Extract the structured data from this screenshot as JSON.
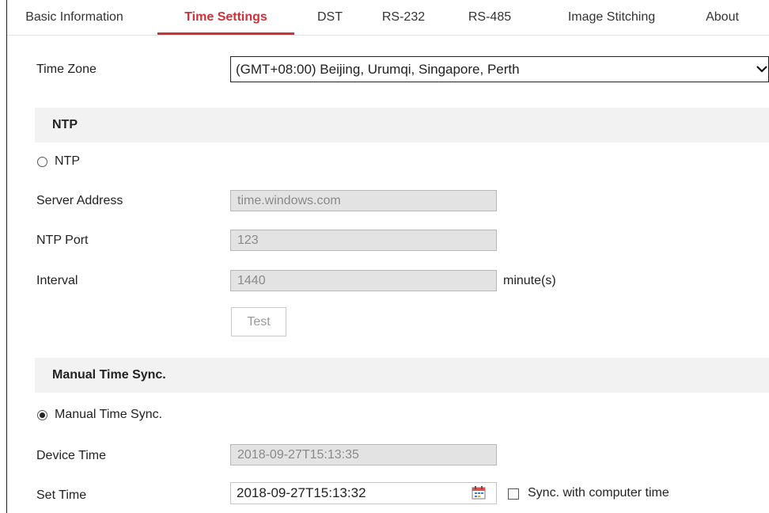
{
  "tabs": [
    {
      "label": "Basic Information",
      "active": false
    },
    {
      "label": "Time Settings",
      "active": true
    },
    {
      "label": "DST",
      "active": false
    },
    {
      "label": "RS-232",
      "active": false
    },
    {
      "label": "RS-485",
      "active": false
    },
    {
      "label": "Image Stitching",
      "active": false
    },
    {
      "label": "About",
      "active": false
    }
  ],
  "time_zone": {
    "label": "Time Zone",
    "value": "(GMT+08:00) Beijing, Urumqi, Singapore, Perth"
  },
  "ntp": {
    "section_title": "NTP",
    "radio_label": "NTP",
    "selected": false,
    "server_address": {
      "label": "Server Address",
      "value": "time.windows.com"
    },
    "ntp_port": {
      "label": "NTP Port",
      "value": "123"
    },
    "interval": {
      "label": "Interval",
      "value": "1440",
      "unit": "minute(s)"
    },
    "test_button": "Test"
  },
  "manual": {
    "section_title": "Manual Time Sync.",
    "radio_label": "Manual Time Sync.",
    "selected": true,
    "device_time": {
      "label": "Device Time",
      "value": "2018-09-27T15:13:35"
    },
    "set_time": {
      "label": "Set Time",
      "value": "2018-09-27T15:13:32"
    },
    "sync_checkbox": {
      "label": "Sync. with computer time",
      "checked": false
    }
  },
  "colors": {
    "accent": "#d0303a",
    "section_bg": "#f2f2f2",
    "disabled_field": "#e3e3e3"
  },
  "icons": {
    "calendar": "calendar-icon",
    "dropdown": "chevron-down-icon"
  }
}
